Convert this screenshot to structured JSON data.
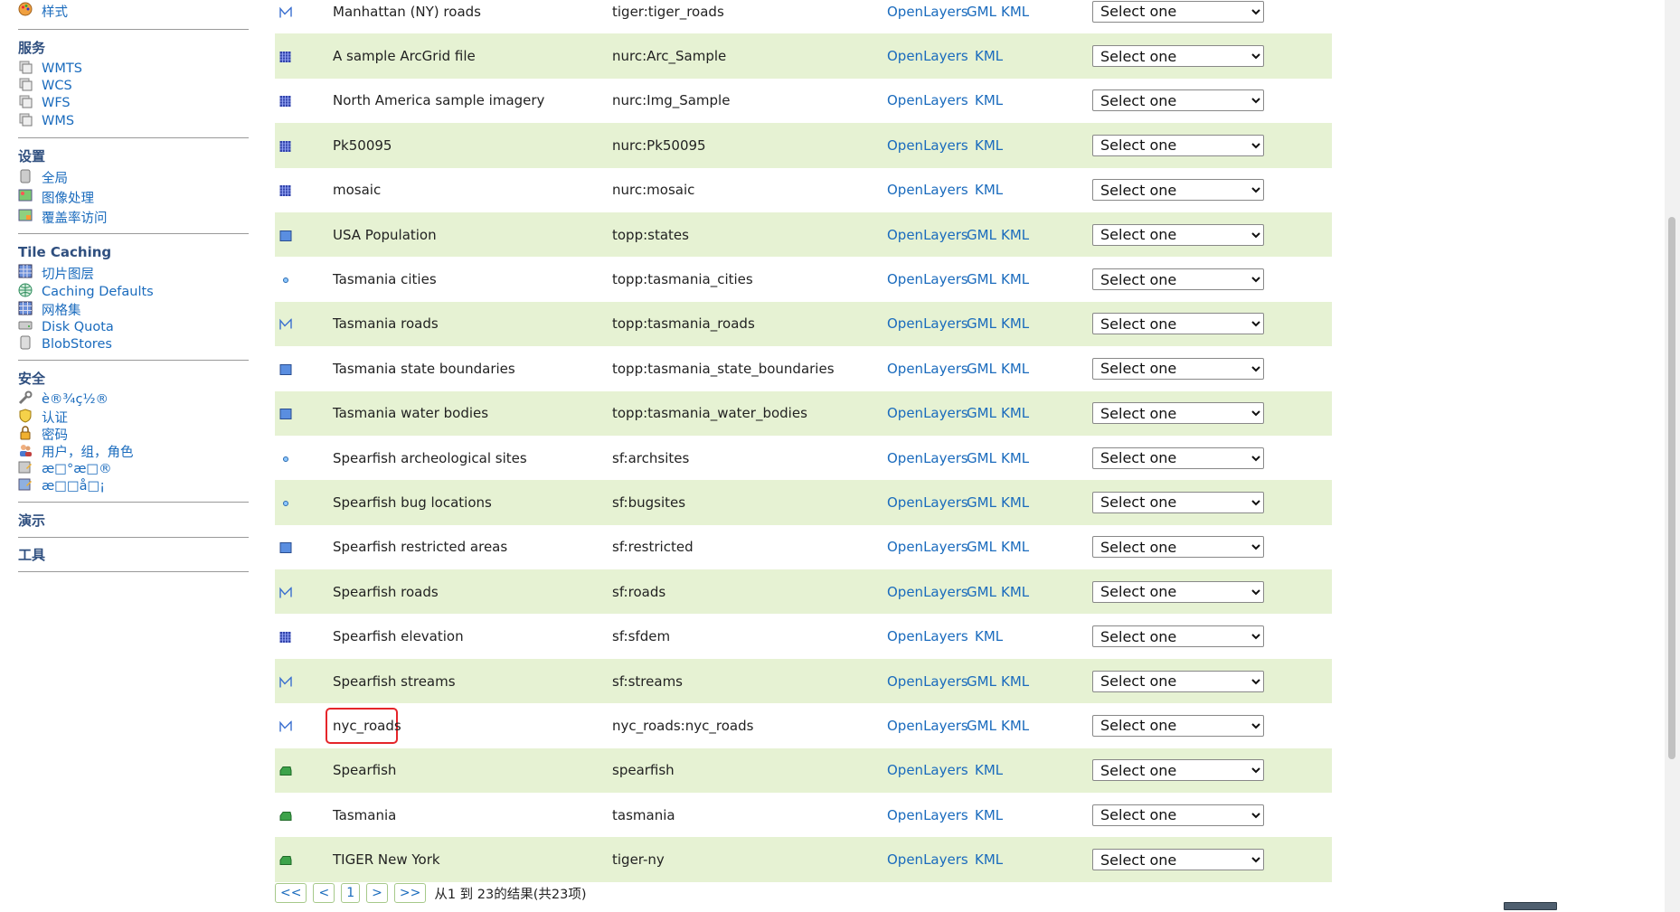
{
  "sidebar": {
    "style_item": {
      "label": "样式",
      "icon": "style-icon"
    },
    "services": {
      "title": "服务",
      "items": [
        {
          "label": "WMTS",
          "icon": "service-icon"
        },
        {
          "label": "WCS",
          "icon": "service-icon"
        },
        {
          "label": "WFS",
          "icon": "service-icon"
        },
        {
          "label": "WMS",
          "icon": "service-icon"
        }
      ]
    },
    "settings": {
      "title": "设置",
      "items": [
        {
          "label": "全局",
          "icon": "server-icon"
        },
        {
          "label": "图像处理",
          "icon": "image-icon"
        },
        {
          "label": "覆盖率访问",
          "icon": "coverage-icon"
        }
      ]
    },
    "tile_caching": {
      "title": "Tile Caching",
      "items": [
        {
          "label": "切片图层",
          "icon": "grid-layers-icon"
        },
        {
          "label": "Caching Defaults",
          "icon": "globe-icon"
        },
        {
          "label": "网格集",
          "icon": "grid-icon"
        },
        {
          "label": "Disk Quota",
          "icon": "drive-icon"
        },
        {
          "label": "BlobStores",
          "icon": "drive-icon"
        }
      ]
    },
    "security": {
      "title": "安全",
      "items": [
        {
          "label": "è®¾ç½®",
          "icon": "wrench-icon"
        },
        {
          "label": "认证",
          "icon": "shield-icon"
        },
        {
          "label": "密码",
          "icon": "lock-icon"
        },
        {
          "label": "用户，组，角色",
          "icon": "users-icon"
        },
        {
          "label": "æ□°æ□®",
          "icon": "data-security-icon"
        },
        {
          "label": "æ□□å□¡",
          "icon": "service-security-icon"
        }
      ]
    },
    "demo": {
      "title": "演示"
    },
    "tools": {
      "title": "工具"
    }
  },
  "table": {
    "rows": [
      {
        "type": "line",
        "title": "Manhattan (NY) roads",
        "name": "tiger:tiger_roads",
        "links": [
          "OpenLayers",
          "GML",
          "KML"
        ],
        "select": "Select one"
      },
      {
        "type": "raster",
        "title": "A sample ArcGrid file",
        "name": "nurc:Arc_Sample",
        "links": [
          "OpenLayers",
          "KML"
        ],
        "select": "Select one"
      },
      {
        "type": "raster",
        "title": "North America sample imagery",
        "name": "nurc:Img_Sample",
        "links": [
          "OpenLayers",
          "KML"
        ],
        "select": "Select one"
      },
      {
        "type": "raster",
        "title": "Pk50095",
        "name": "nurc:Pk50095",
        "links": [
          "OpenLayers",
          "KML"
        ],
        "select": "Select one"
      },
      {
        "type": "raster",
        "title": "mosaic",
        "name": "nurc:mosaic",
        "links": [
          "OpenLayers",
          "KML"
        ],
        "select": "Select one"
      },
      {
        "type": "polygon",
        "title": "USA Population",
        "name": "topp:states",
        "links": [
          "OpenLayers",
          "GML",
          "KML"
        ],
        "select": "Select one"
      },
      {
        "type": "point",
        "title": "Tasmania cities",
        "name": "topp:tasmania_cities",
        "links": [
          "OpenLayers",
          "GML",
          "KML"
        ],
        "select": "Select one"
      },
      {
        "type": "line",
        "title": "Tasmania roads",
        "name": "topp:tasmania_roads",
        "links": [
          "OpenLayers",
          "GML",
          "KML"
        ],
        "select": "Select one"
      },
      {
        "type": "polygon",
        "title": "Tasmania state boundaries",
        "name": "topp:tasmania_state_boundaries",
        "links": [
          "OpenLayers",
          "GML",
          "KML"
        ],
        "select": "Select one"
      },
      {
        "type": "polygon",
        "title": "Tasmania water bodies",
        "name": "topp:tasmania_water_bodies",
        "links": [
          "OpenLayers",
          "GML",
          "KML"
        ],
        "select": "Select one"
      },
      {
        "type": "point",
        "title": "Spearfish archeological sites",
        "name": "sf:archsites",
        "links": [
          "OpenLayers",
          "GML",
          "KML"
        ],
        "select": "Select one"
      },
      {
        "type": "point",
        "title": "Spearfish bug locations",
        "name": "sf:bugsites",
        "links": [
          "OpenLayers",
          "GML",
          "KML"
        ],
        "select": "Select one"
      },
      {
        "type": "polygon",
        "title": "Spearfish restricted areas",
        "name": "sf:restricted",
        "links": [
          "OpenLayers",
          "GML",
          "KML"
        ],
        "select": "Select one"
      },
      {
        "type": "line",
        "title": "Spearfish roads",
        "name": "sf:roads",
        "links": [
          "OpenLayers",
          "GML",
          "KML"
        ],
        "select": "Select one"
      },
      {
        "type": "raster",
        "title": "Spearfish elevation",
        "name": "sf:sfdem",
        "links": [
          "OpenLayers",
          "KML"
        ],
        "select": "Select one"
      },
      {
        "type": "line",
        "title": "Spearfish streams",
        "name": "sf:streams",
        "links": [
          "OpenLayers",
          "GML",
          "KML"
        ],
        "select": "Select one"
      },
      {
        "type": "line",
        "title": "nyc_roads",
        "name": "nyc_roads:nyc_roads",
        "links": [
          "OpenLayers",
          "GML",
          "KML"
        ],
        "select": "Select one",
        "highlighted": true
      },
      {
        "type": "group",
        "title": "Spearfish",
        "name": "spearfish",
        "links": [
          "OpenLayers",
          "KML"
        ],
        "select": "Select one"
      },
      {
        "type": "group",
        "title": "Tasmania",
        "name": "tasmania",
        "links": [
          "OpenLayers",
          "KML"
        ],
        "select": "Select one"
      },
      {
        "type": "group",
        "title": "TIGER New York",
        "name": "tiger-ny",
        "links": [
          "OpenLayers",
          "KML"
        ],
        "select": "Select one"
      }
    ]
  },
  "pager": {
    "first": "<<",
    "prev": "<",
    "page": "1",
    "next": ">",
    "last": ">>",
    "info": "从1 到 23的结果(共23项)"
  },
  "colors": {
    "row_alt": "#e6f2d3",
    "link": "#1a6bbd",
    "section_title": "#2f4f7f",
    "highlight": "#e5252a"
  }
}
